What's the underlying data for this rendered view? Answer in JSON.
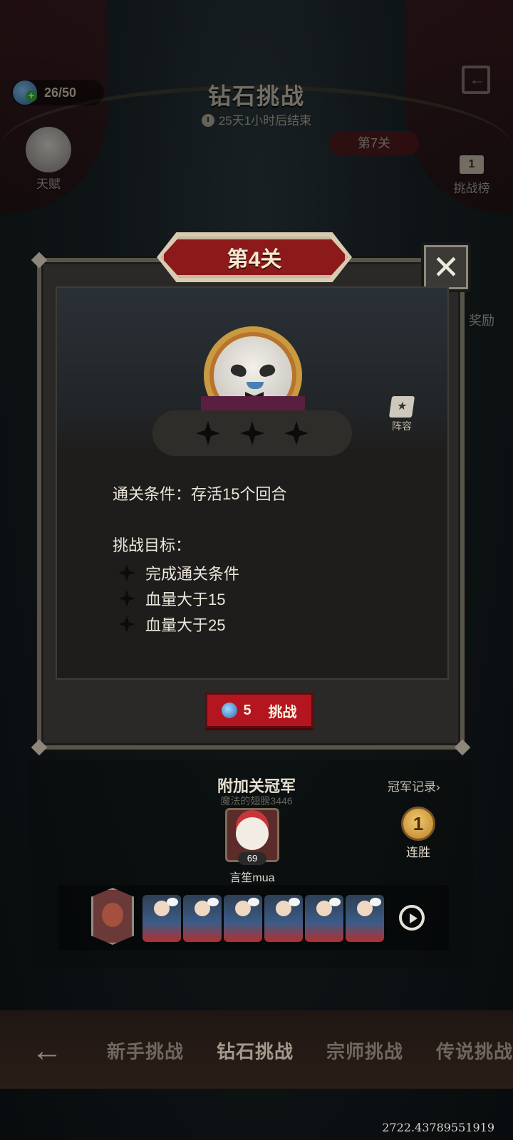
{
  "topbar": {
    "stamina": "26/50",
    "title": "钻石挑战",
    "timer": "25天1小时后结束",
    "level_badge": "第7关"
  },
  "side": {
    "talent_label": "天赋",
    "rank_label": "挑战榜",
    "rank_icon_text": "1",
    "reward_label": "奖励"
  },
  "modal": {
    "stage_title": "第4关",
    "close_label": "✕",
    "lineup_label": "阵容",
    "stars_total": 3,
    "stars_earned": 0,
    "clear_condition": "通关条件：存活15个回合",
    "goal_title": "挑战目标：",
    "goals": [
      "完成通关条件",
      "血量大于15",
      "血量大于25"
    ],
    "challenge_cost": "5",
    "challenge_label": "挑战"
  },
  "champion": {
    "title": "附加关冠军",
    "subtitle": "魔法的翅膀3446",
    "record_link": "冠军记录›",
    "player_level": "69",
    "player_name": "言笙mua",
    "streak_count": "1",
    "streak_label": "连胜",
    "team_member_count": 6
  },
  "bottom_tabs": {
    "back": "←",
    "items": [
      "新手挑战",
      "钻石挑战",
      "宗师挑战",
      "传说挑战"
    ],
    "active_index": 1
  },
  "footer": {
    "coord_text": "2722.43789551919"
  }
}
